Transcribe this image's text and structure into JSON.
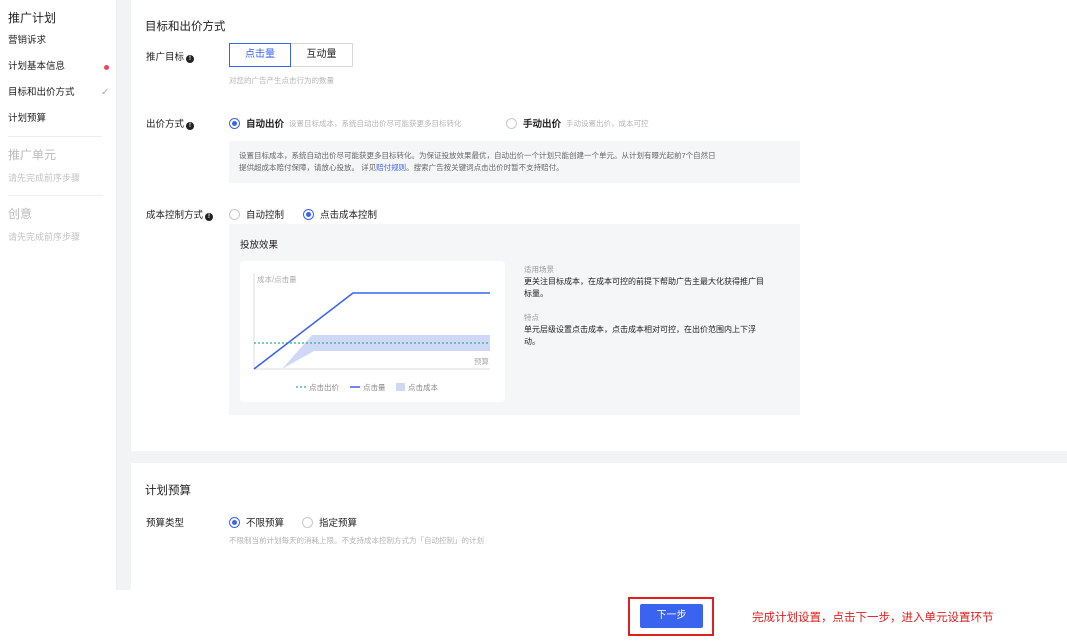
{
  "sidebar": {
    "section1_title": "推广计划",
    "items": [
      {
        "label": "营销诉求"
      },
      {
        "label": "计划基本信息"
      },
      {
        "label": "目标和出价方式"
      },
      {
        "label": "计划预算"
      }
    ],
    "section2_title": "推广单元",
    "section2_hint": "请先完成前序步骤",
    "section3_title": "创意",
    "section3_hint": "请先完成前序步骤"
  },
  "target_section": {
    "title": "目标和出价方式",
    "goal_label": "推广目标",
    "goal_options": [
      "点击量",
      "互动量"
    ],
    "goal_selected": "点击量",
    "goal_hint": "对您的广告产生点击行为的数量",
    "bid_label": "出价方式",
    "bid_auto": "自动出价",
    "bid_auto_desc": "设置目标成本，系统自动出价尽可能获更多目标转化",
    "bid_manual": "手动出价",
    "bid_manual_desc": "手动设置出价，成本可控",
    "notice_text1": "设置目标成本，系统自动出价尽可能获更多目标转化。为保证投放效果最优，自动出价一个计划只能创建一个单元。从计划有曝光起前7个自然日",
    "notice_text2": "提供超成本赔付保障，请放心投放。 详见",
    "notice_link": "赔付规则",
    "notice_text3": "。搜索广告按关键词点击出价时暂不支持赔付。",
    "cost_label": "成本控制方式",
    "cost_auto": "自动控制",
    "cost_click": "点击成本控制",
    "effect_title": "投放效果",
    "scene_key": "适用场景",
    "scene_value1": "更关注目标成本，在成本可控的前提下帮助广告主最大化获得推广目",
    "scene_value2": "标量。",
    "feature_key": "特点",
    "feature_value1": "单元层级设置点击成本，点击成本相对可控，在出价范围内上下浮",
    "feature_value2": "动。"
  },
  "chart_data": {
    "type": "line",
    "ylabel": "成本/点击量",
    "xlabel": "预算",
    "legend": [
      "点击出价",
      "点击量",
      "点击成本"
    ],
    "colors": {
      "bid": "#2fb28b",
      "clicks": "#3a63f0",
      "cost_band": "#cfd9f7"
    }
  },
  "budget_section": {
    "title": "计划预算",
    "type_label": "预算类型",
    "opt_unlimited": "不限预算",
    "opt_fixed": "指定预算",
    "hint": "不限制当前计划每天的消耗上限。不支持成本控制方式为「自动控制」的计划"
  },
  "footer": {
    "next_label": "下一步",
    "annotation": "完成计划设置，点击下一步，进入单元设置环节"
  },
  "colors": {
    "accent": "#3a63f0",
    "annotation_red": "#e02020"
  }
}
